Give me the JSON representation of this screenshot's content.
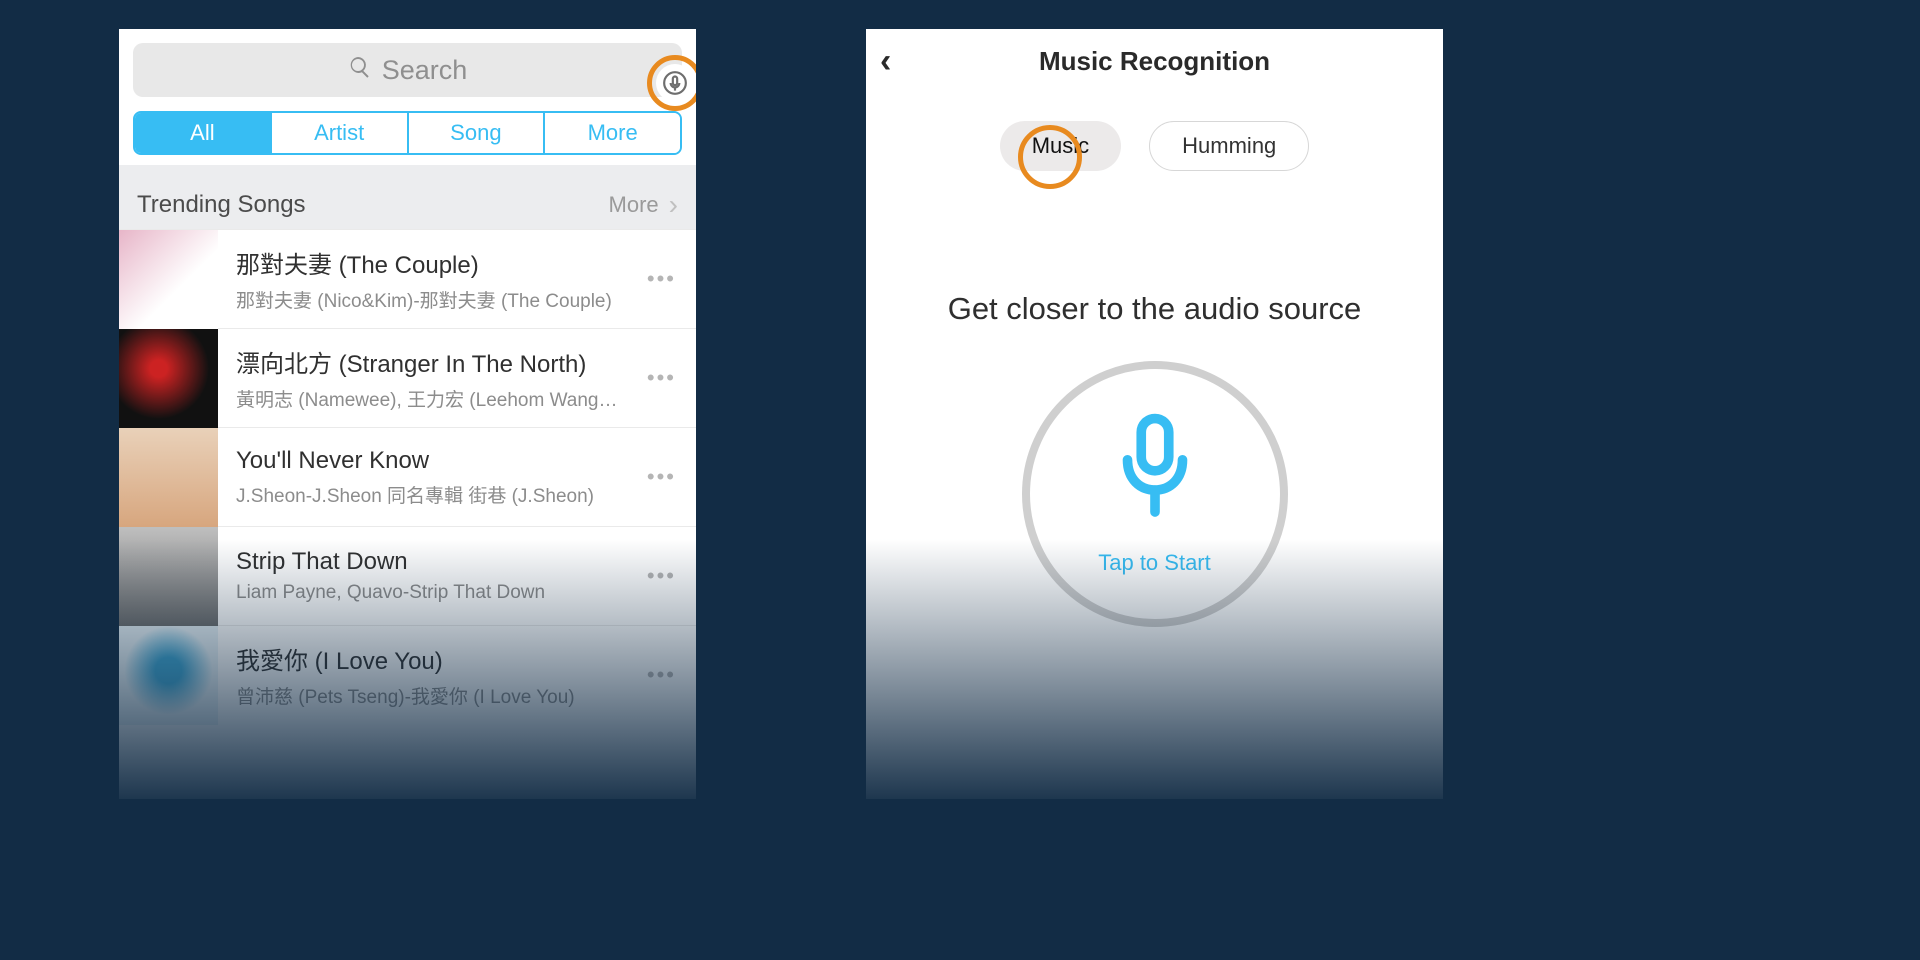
{
  "left": {
    "search_placeholder": "Search",
    "tabs": [
      "All",
      "Artist",
      "Song",
      "More"
    ],
    "active_tab": 0,
    "trending_header": "Trending Songs",
    "trending_more": "More",
    "songs": [
      {
        "title": "那對夫妻 (The Couple)",
        "subtitle": "那對夫妻 (Nico&Kim)-那對夫妻 (The Couple)"
      },
      {
        "title": "漂向北方 (Stranger In The North)",
        "subtitle": "黃明志 (Namewee), 王力宏 (Leehom Wang)-..."
      },
      {
        "title": "You'll Never Know",
        "subtitle": "J.Sheon-J.Sheon 同名專輯 街巷 (J.Sheon)"
      },
      {
        "title": "Strip That Down",
        "subtitle": "Liam Payne, Quavo-Strip That Down"
      },
      {
        "title": "我愛你 (I Love You)",
        "subtitle": "曾沛慈 (Pets Tseng)-我愛你 (I Love You)"
      }
    ]
  },
  "right": {
    "title": "Music Recognition",
    "modes": [
      "Music",
      "Humming"
    ],
    "active_mode": 0,
    "instruction": "Get closer to the audio source",
    "tap_label": "Tap to Start"
  },
  "colors": {
    "accent": "#37bdf3",
    "highlight": "#e88a1f"
  }
}
